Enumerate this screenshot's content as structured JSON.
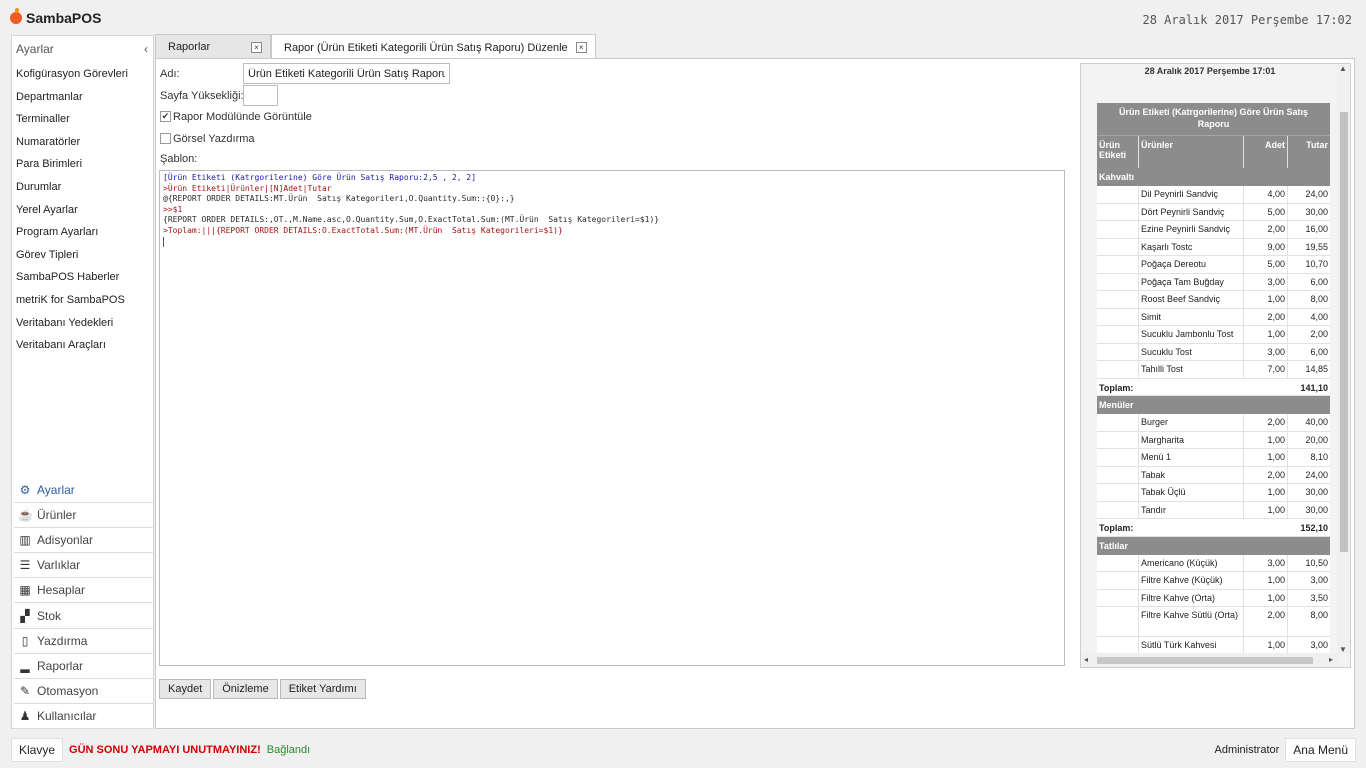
{
  "app": {
    "name": "SambaPOS",
    "datetime": "28 Aralık 2017 Perşembe 17:02"
  },
  "sidebar": {
    "header": "Ayarlar",
    "collapse_glyph": "‹",
    "items": [
      "Kofigürasyon Görevleri",
      "Departmanlar",
      "Terminaller",
      "Numaratörler",
      "Para Birimleri",
      "Durumlar",
      "Yerel Ayarlar",
      "Program Ayarları",
      "Görev Tipleri",
      "SambaPOS Haberler",
      "metriK for SambaPOS",
      "Veritabanı Yedekleri",
      "Veritabanı Araçları"
    ],
    "nav": [
      {
        "label": "Ayarlar",
        "icon": "gear-icon",
        "active": true
      },
      {
        "label": "Ürünler",
        "icon": "coffee-icon"
      },
      {
        "label": "Adisyonlar",
        "icon": "books-icon"
      },
      {
        "label": "Varlıklar",
        "icon": "list-icon"
      },
      {
        "label": "Hesaplar",
        "icon": "calculator-icon"
      },
      {
        "label": "Stok",
        "icon": "boxes-icon"
      },
      {
        "label": "Yazdırma",
        "icon": "document-icon"
      },
      {
        "label": "Raporlar",
        "icon": "bar-chart-icon"
      },
      {
        "label": "Otomasyon",
        "icon": "pencil-icon"
      },
      {
        "label": "Kullanıcılar",
        "icon": "user-icon"
      }
    ]
  },
  "tabs": [
    {
      "label": "Raporlar",
      "close": "×"
    },
    {
      "label": "Rapor (Ürün Etiketi Kategorili Ürün Satış Raporu) Düzenle",
      "close": "×"
    }
  ],
  "form": {
    "name_label": "Adı:",
    "name_value": "Ürün Etiketi Kategorili Ürün Satış Raporu",
    "page_height_label": "Sayfa Yüksekliği:",
    "page_height_value": "",
    "report_module_label": "Rapor Modülünde Görüntüle",
    "report_module_checked": true,
    "visual_print_label": "Görsel Yazdırma",
    "visual_print_checked": false,
    "template_label": "Şablon:",
    "template_lines": [
      {
        "text": "[Ürün Etiketi (Katrgorilerine) Göre Ürün Satış Raporu:2,5 , 2, 2]",
        "color": "blue"
      },
      {
        "text": ">Ürün Etiketi|Ürünler|[N]Adet|Tutar",
        "color": "red"
      },
      {
        "text": "@{REPORT ORDER DETAILS:MT.Ürün  Satış Kategorileri,O.Quantity.Sum::{0}:,}",
        "color": "dark"
      },
      {
        "text": ">>$1",
        "color": "red"
      },
      {
        "text": "{REPORT ORDER DETAILS:,OT.,M.Name.asc,O.Quantity.Sum,O.ExactTotal.Sum:(MT.Ürün  Satış Kategorileri=$1)}",
        "color": "dark"
      },
      {
        "text": ">Toplam:|||{REPORT ORDER DETAILS:O.ExactTotal.Sum:(MT.Ürün  Satış Kategorileri=$1)}",
        "color": "red"
      }
    ]
  },
  "buttons": {
    "save": "Kaydet",
    "preview": "Önizleme",
    "tag_help": "Etiket Yardımı"
  },
  "preview": {
    "date": "28 Aralık 2017 Perşembe 17:01",
    "title": "Ürün Etiketi (Katrgorilerine) Göre Ürün Satış Raporu",
    "headers": [
      "Ürün Etiketi",
      "Ürünler",
      "Adet",
      "Tutar"
    ],
    "total_label": "Toplam:",
    "groups": [
      {
        "name": "Kahvaltı",
        "rows": [
          [
            "Dil Peynirli Sandviç",
            "4,00",
            "24,00"
          ],
          [
            "Dört Peynirli Sandviç",
            "5,00",
            "30,00"
          ],
          [
            "Ezine Peynirli Sandviç",
            "2,00",
            "16,00"
          ],
          [
            "Kaşarlı Tostc",
            "9,00",
            "19,55"
          ],
          [
            "Poğaça Dereotu",
            "5,00",
            "10,70"
          ],
          [
            "Poğaça Tam Buğday",
            "3,00",
            "6,00"
          ],
          [
            "Roost Beef Sandviç",
            "1,00",
            "8,00"
          ],
          [
            "Simit",
            "2,00",
            "4,00"
          ],
          [
            "Sucuklu Jambonlu Tost",
            "1,00",
            "2,00"
          ],
          [
            "Sucuklu Tost",
            "3,00",
            "6,00"
          ],
          [
            "Tahılli Tost",
            "7,00",
            "14,85"
          ]
        ],
        "total": "141,10"
      },
      {
        "name": "Menüler",
        "rows": [
          [
            "Burger",
            "2,00",
            "40,00"
          ],
          [
            "Margharita",
            "1,00",
            "20,00"
          ],
          [
            "Menü 1",
            "1,00",
            "8,10"
          ],
          [
            "Tabak",
            "2,00",
            "24,00"
          ],
          [
            "Tabak Üçlü",
            "1,00",
            "30,00"
          ],
          [
            "Tandır",
            "1,00",
            "30,00"
          ]
        ],
        "total": "152,10"
      },
      {
        "name": "Tatlılar",
        "rows": [
          [
            "Americano (Küçük)",
            "3,00",
            "10,50"
          ],
          [
            "Filtre Kahve (Küçük)",
            "1,00",
            "3,00"
          ],
          [
            "Filtre Kahve (Orta)",
            "1,00",
            "3,50"
          ],
          [
            "Filtre Kahve Sütlü (Orta)",
            "2,00",
            "8,00"
          ],
          [
            "Sütlü Türk Kahvesi",
            "1,00",
            "3,00"
          ]
        ],
        "total": null
      }
    ]
  },
  "status": {
    "keyboard": "Klavye",
    "warning": "GÜN SONU YAPMAYI UNUTMAYINIZ!",
    "connected": "Bağlandı",
    "user": "Administrator",
    "main_menu": "Ana Menü"
  }
}
